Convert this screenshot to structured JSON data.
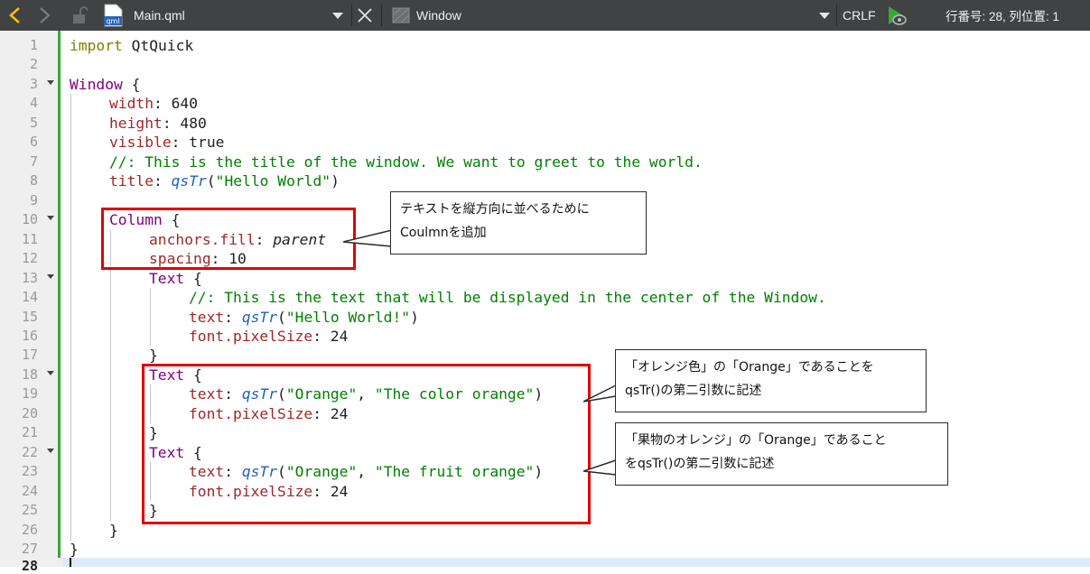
{
  "toolbar": {
    "file_name": "Main.qml",
    "file_icon_label": "qml",
    "symbol": "Window",
    "line_ending": "CRLF",
    "position": "行番号: 28, 列位置: 1"
  },
  "line_numbers": [
    "1",
    "2",
    "3",
    "4",
    "5",
    "6",
    "7",
    "8",
    "9",
    "10",
    "11",
    "12",
    "13",
    "14",
    "15",
    "16",
    "17",
    "18",
    "19",
    "20",
    "21",
    "22",
    "23",
    "24",
    "25",
    "26",
    "27",
    "28"
  ],
  "code": {
    "l1_kw": "import",
    "l1_rest": " QtQuick",
    "l3_type": "Window",
    "l3_rest": " {",
    "l4_prop": "width",
    "l4_rest": ": 640",
    "l5_prop": "height",
    "l5_rest": ": 480",
    "l6_prop": "visible",
    "l6_rest": ": true",
    "l7_comment": "//: This is the title of the window. We want to greet to the world.",
    "l8_prop": "title",
    "l8_colon": ": ",
    "l8_fn": "qsTr",
    "l8_open": "(",
    "l8_str": "\"Hello World\"",
    "l8_close": ")",
    "l10_type": "Column",
    "l10_rest": " {",
    "l11_prop": "anchors.fill",
    "l11_colon": ": ",
    "l11_val": "parent",
    "l12_prop": "spacing",
    "l12_rest": ": 10",
    "l13_type": "Text",
    "l13_rest": " {",
    "l14_comment": "//: This is the text that will be displayed in the center of the Window.",
    "l15_prop": "text",
    "l15_colon": ": ",
    "l15_fn": "qsTr",
    "l15_open": "(",
    "l15_str": "\"Hello World!\"",
    "l15_close": ")",
    "l16_prop": "font.pixelSize",
    "l16_rest": ": 24",
    "l17_brace": "}",
    "l18_type": "Text",
    "l18_rest": " {",
    "l19_prop": "text",
    "l19_colon": ": ",
    "l19_fn": "qsTr",
    "l19_open": "(",
    "l19_str1": "\"Orange\"",
    "l19_comma": ", ",
    "l19_str2": "\"The color orange\"",
    "l19_close": ")",
    "l20_prop": "font.pixelSize",
    "l20_rest": ": 24",
    "l21_brace": "}",
    "l22_type": "Text",
    "l22_rest": " {",
    "l23_prop": "text",
    "l23_colon": ": ",
    "l23_fn": "qsTr",
    "l23_open": "(",
    "l23_str1": "\"Orange\"",
    "l23_comma": ", ",
    "l23_str2": "\"The fruit orange\"",
    "l23_close": ")",
    "l24_prop": "font.pixelSize",
    "l24_rest": ": 24",
    "l25_brace": "}",
    "l26_brace": "}",
    "l27_brace": "}"
  },
  "callouts": {
    "c1_line1": "テキストを縦方向に並べるために",
    "c1_line2": "Coulmnを追加",
    "c2_line1": "「オレンジ色」の「Orange」であることを",
    "c2_line2": "qsTr()の第二引数に記述",
    "c3_line1": "「果物のオレンジ」の「Orange」であること",
    "c3_line2": "をqsTr()の第二引数に記述"
  },
  "colors": {
    "toolbar_bg": "#404244",
    "annotation_red": "#e00000",
    "modified_bar": "#3aa63a",
    "keyword": "#808000",
    "type": "#800080",
    "property": "#a02828",
    "string": "#008000",
    "function": "#1f5fbf"
  }
}
